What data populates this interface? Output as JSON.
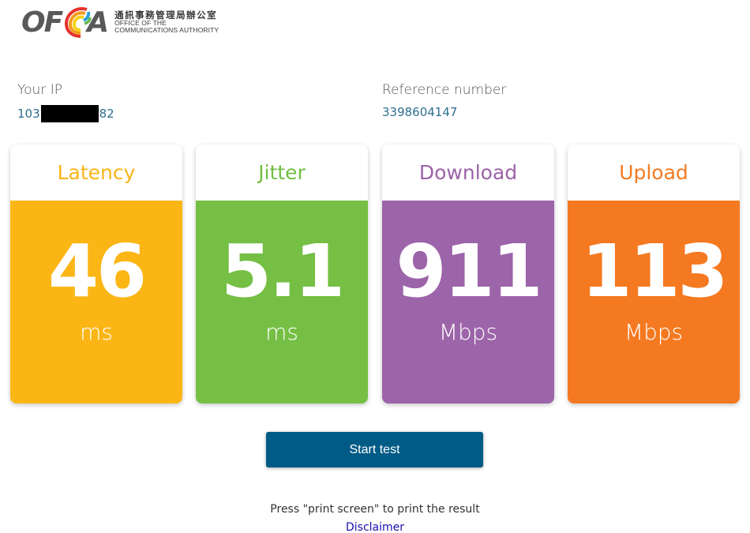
{
  "logo": {
    "of": "OF",
    "a": "A",
    "chinese": "通訊事務管理局辦公室",
    "english_line1": "OFFICE OF THE",
    "english_line2": "COMMUNICATIONS AUTHORITY"
  },
  "ip": {
    "label": "Your IP",
    "prefix": "103",
    "suffix": "82"
  },
  "reference": {
    "label": "Reference number",
    "value": "3398604147"
  },
  "metrics": [
    {
      "title": "Latency",
      "value": "46",
      "unit": "ms",
      "title_color": "#f7b519",
      "body_color": "#fbb616"
    },
    {
      "title": "Jitter",
      "value": "5.1",
      "unit": "ms",
      "title_color": "#71bf43",
      "body_color": "#75bf44"
    },
    {
      "title": "Download",
      "value": "911",
      "unit": "Mbps",
      "title_color": "#9b62a8",
      "body_color": "#9c64a9"
    },
    {
      "title": "Upload",
      "value": "113",
      "unit": "Mbps",
      "title_color": "#f37b22",
      "body_color": "#f47920"
    }
  ],
  "start_button": "Start test",
  "print_note": "Press \"print screen\" to print the result",
  "disclaimer": "Disclaimer"
}
